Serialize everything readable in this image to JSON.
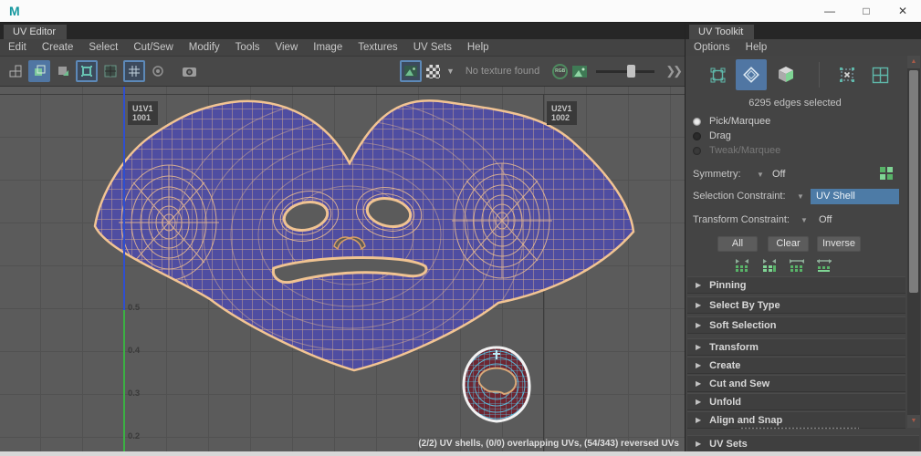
{
  "window": {
    "app_icon": "M",
    "minimize": "—",
    "maximize": "□",
    "close": "✕"
  },
  "uv_editor": {
    "tab": "UV Editor",
    "menus": [
      "Edit",
      "Create",
      "Select",
      "Cut/Sew",
      "Modify",
      "Tools",
      "View",
      "Image",
      "Textures",
      "UV Sets",
      "Help"
    ],
    "toolbar": {
      "texture_status": "No texture found",
      "rgb_badge": "RGB"
    },
    "canvas": {
      "tiles": [
        {
          "uv": "U1V1",
          "udim": "1001"
        },
        {
          "uv": "U2V1",
          "udim": "1002"
        }
      ],
      "axis_ticks": [
        "0.5",
        "0.4",
        "0.3",
        "0.2"
      ],
      "status": "(2/2) UV shells, (0/0) overlapping UVs, (54/343) reversed UVs"
    },
    "toolbar_icons": [
      "uv-tiles",
      "shell-layout",
      "cut-shell",
      "shell-border",
      "grid-snap",
      "grid-display",
      "dim-image",
      "snapshot",
      "texture-image",
      "checker-map",
      "texture-dropdown",
      "rgb-channels",
      "exposure-image",
      "dim-slider",
      "expand-toolbar"
    ]
  },
  "uv_toolkit": {
    "tab": "UV Toolkit",
    "menus": [
      "Options",
      "Help"
    ],
    "selection_status": "6295 edges selected",
    "select_icons": [
      "vertex-selection",
      "edge-selection",
      "face-selection",
      "uv-selection",
      "uv-shell-selection"
    ],
    "modes": [
      {
        "label": "Pick/Marquee",
        "state": "selected"
      },
      {
        "label": "Drag",
        "state": "normal"
      },
      {
        "label": "Tweak/Marquee",
        "state": "disabled"
      }
    ],
    "symmetry": {
      "label": "Symmetry:",
      "value": "Off"
    },
    "selection_constraint": {
      "label": "Selection Constraint:",
      "value": "UV Shell"
    },
    "transform_constraint": {
      "label": "Transform Constraint:",
      "value": "Off"
    },
    "buttons": [
      "All",
      "Clear",
      "Inverse"
    ],
    "grow_icons": [
      "shrink-selection",
      "grow-selection",
      "select-edge-loop",
      "select-edge-ring"
    ],
    "sections_top": [
      "Pinning",
      "Select By Type",
      "Soft Selection"
    ],
    "sections_main": [
      "Transform",
      "Create",
      "Cut and Sew",
      "Unfold",
      "Align and Snap"
    ],
    "section_bottom": "UV Sets"
  },
  "colors": {
    "accent_blue": "#5076a3",
    "teal_icon": "#5fb8aa",
    "mesh_fill": "#4f4da1",
    "wireframe": "#eebd90",
    "axis_blue": "#2f4fd0",
    "axis_green": "#3bb143",
    "shell_fill": "#6e2631",
    "shell_wire": "#58c6e6",
    "highlight_field": "#4d7ba6"
  }
}
